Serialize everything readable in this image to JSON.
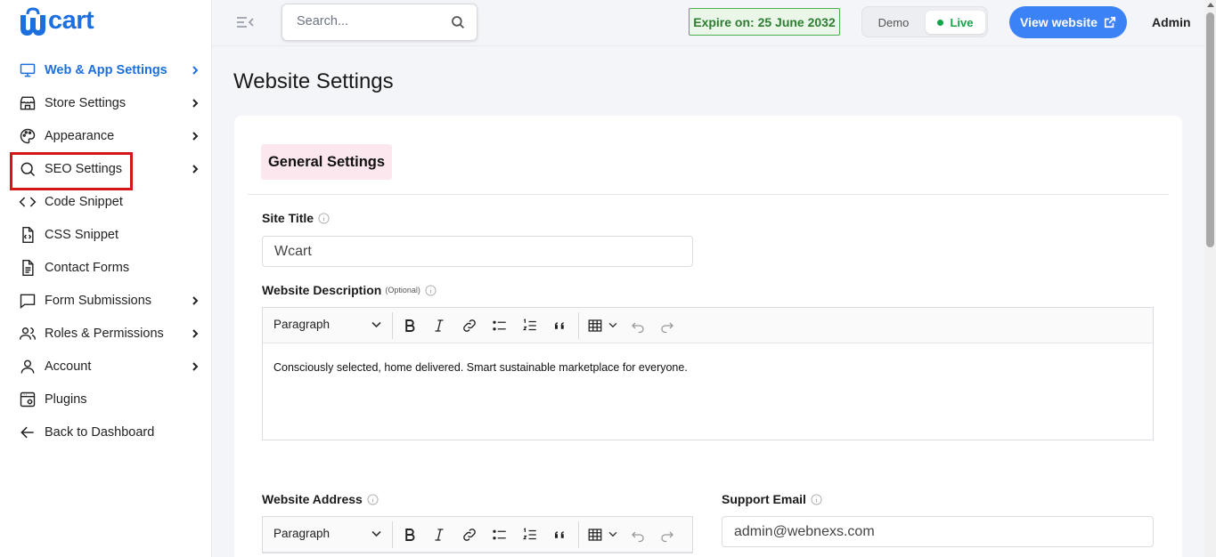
{
  "brand": {
    "logo_text": "Wcart",
    "colors": {
      "accent": "#1d6fe0",
      "button": "#3b82f6",
      "highlight": "#d4161c"
    }
  },
  "sidebar": {
    "items": [
      {
        "label": "Web & App Settings",
        "icon": "monitor-icon",
        "has_chevron": true,
        "active": true
      },
      {
        "label": "Store Settings",
        "icon": "store-icon",
        "has_chevron": true
      },
      {
        "label": "Appearance",
        "icon": "palette-icon",
        "has_chevron": true
      },
      {
        "label": "SEO Settings",
        "icon": "search-icon",
        "has_chevron": true,
        "highlighted": true
      },
      {
        "label": "Code Snippet",
        "icon": "code-icon",
        "has_chevron": false
      },
      {
        "label": "CSS Snippet",
        "icon": "file-code-icon",
        "has_chevron": false
      },
      {
        "label": "Contact Forms",
        "icon": "document-icon",
        "has_chevron": false
      },
      {
        "label": "Form Submissions",
        "icon": "message-icon",
        "has_chevron": true
      },
      {
        "label": "Roles & Permissions",
        "icon": "users-icon",
        "has_chevron": true
      },
      {
        "label": "Account",
        "icon": "user-icon",
        "has_chevron": true
      },
      {
        "label": "Plugins",
        "icon": "plugin-icon",
        "has_chevron": false
      },
      {
        "label": "Back to Dashboard",
        "icon": "arrow-left-icon",
        "has_chevron": false
      }
    ]
  },
  "topbar": {
    "search_placeholder": "Search...",
    "expire_text": "Expire on: 25 June 2032",
    "mode_demo": "Demo",
    "mode_live": "Live",
    "view_website": "View website",
    "admin": "Admin"
  },
  "main": {
    "page_title": "Website Settings",
    "section_tab": "General Settings",
    "site_title_label": "Site Title",
    "site_title_value": "Wcart",
    "description_label": "Website Description",
    "optional_tag": "(Optional)",
    "editor_paragraph": "Paragraph",
    "description_text": "Consciously selected, home delivered. Smart sustainable marketplace for everyone.",
    "address_label": "Website Address",
    "support_email_label": "Support Email",
    "support_email_value": "admin@webnexs.com"
  }
}
